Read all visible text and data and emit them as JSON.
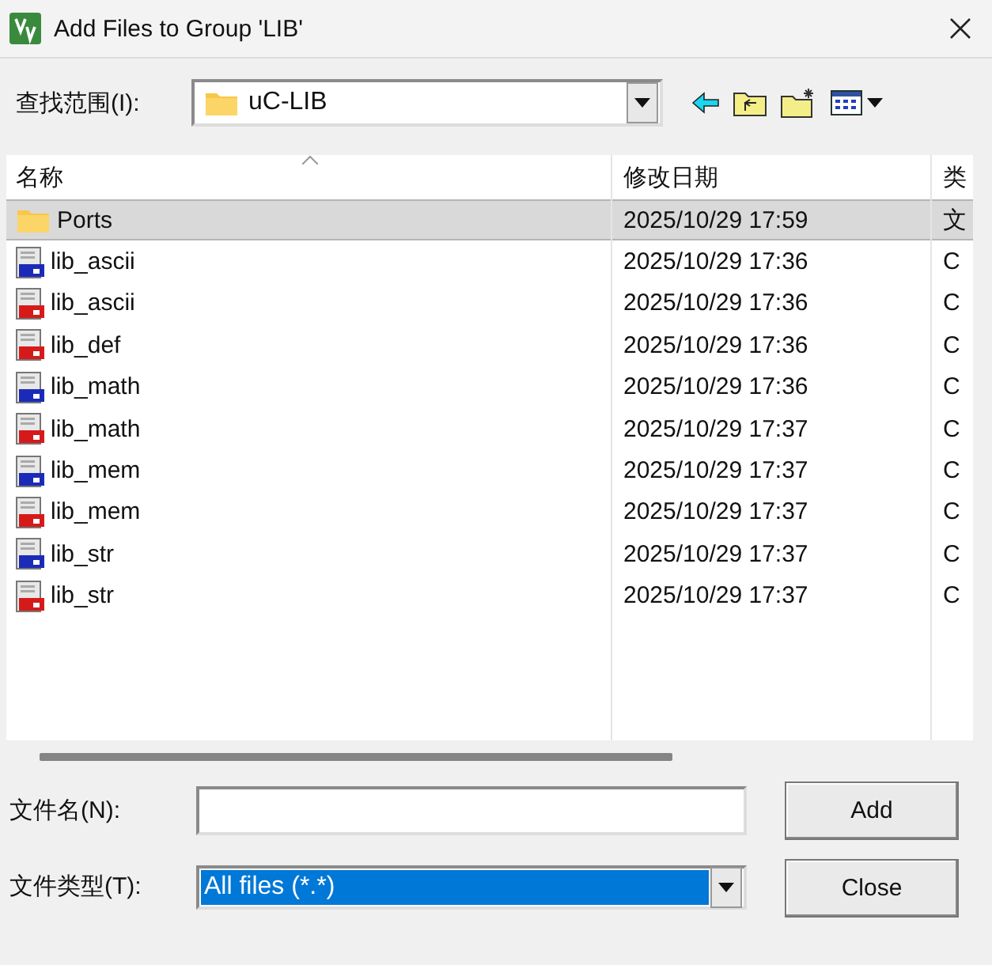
{
  "window": {
    "title": "Add Files to Group 'LIB'"
  },
  "look_in": {
    "label": "查找范围(I):",
    "value": "uC-LIB"
  },
  "columns": [
    "名称",
    "修改日期",
    "类"
  ],
  "rows": [
    {
      "kind": "folder",
      "name": "Ports",
      "date": "2025/10/29 17:59",
      "type": "文",
      "selected": true
    },
    {
      "kind": "c",
      "name": "lib_ascii",
      "date": "2025/10/29 17:36",
      "type": "C",
      "selected": false
    },
    {
      "kind": "h",
      "name": "lib_ascii",
      "date": "2025/10/29 17:36",
      "type": "C",
      "selected": false
    },
    {
      "kind": "h",
      "name": "lib_def",
      "date": "2025/10/29 17:36",
      "type": "C",
      "selected": false
    },
    {
      "kind": "c",
      "name": "lib_math",
      "date": "2025/10/29 17:36",
      "type": "C",
      "selected": false
    },
    {
      "kind": "h",
      "name": "lib_math",
      "date": "2025/10/29 17:37",
      "type": "C",
      "selected": false
    },
    {
      "kind": "c",
      "name": "lib_mem",
      "date": "2025/10/29 17:37",
      "type": "C",
      "selected": false
    },
    {
      "kind": "h",
      "name": "lib_mem",
      "date": "2025/10/29 17:37",
      "type": "C",
      "selected": false
    },
    {
      "kind": "c",
      "name": "lib_str",
      "date": "2025/10/29 17:37",
      "type": "C",
      "selected": false
    },
    {
      "kind": "h",
      "name": "lib_str",
      "date": "2025/10/29 17:37",
      "type": "C",
      "selected": false
    }
  ],
  "file_name": {
    "label": "文件名(N):"
  },
  "file_type": {
    "label": "文件类型(T):",
    "value": "All files (*.*)"
  },
  "buttons": [
    "Add",
    "Close"
  ]
}
